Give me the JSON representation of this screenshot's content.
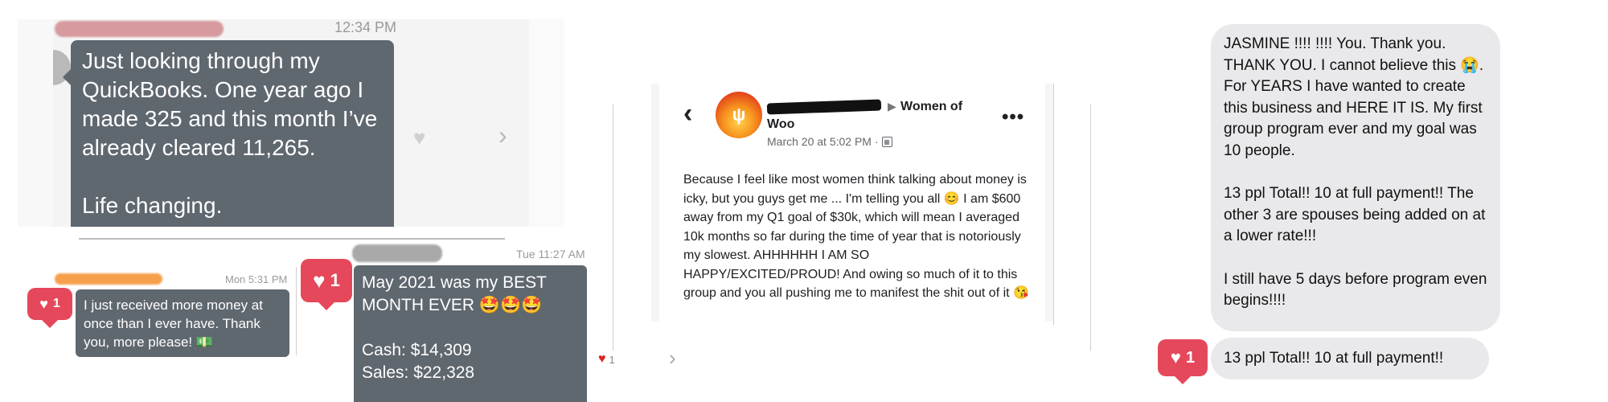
{
  "panel1": {
    "time": "12:34 PM",
    "message": "Just looking through my QuickBooks.  One year ago I made 325 and this month I’ve already cleared 11,265.\n\nLife changing."
  },
  "panel2": {
    "time": "Mon 5:31 PM",
    "message": "I just received more money at once than I ever have. Thank you, more please! 💵",
    "heart_count": "1"
  },
  "panel3": {
    "time": "Tue 11:27 AM",
    "message": "May 2021 was my BEST MONTH EVER 🤩🤩🤩\n\nCash: $14,309\nSales: $22,328",
    "heart_count": "1",
    "reaction_count": "1"
  },
  "panel4": {
    "group": "Women of Woo",
    "date": "March 20 at 5:02 PM · ",
    "post": "Because I feel like most women think talking about money is icky, but you guys get me ... I'm telling you all 😊 I am $600 away from my Q1 goal of $30k, which will mean I averaged 10k months so far during the time of year that is notoriously my slowest. AHHHHHH I AM SO HAPPY/EXCITED/PROUD! And owing so much of it to this group and you all pushing me to manifest the shit out of it 😘"
  },
  "panel5": {
    "message": "JASMINE !!!! !!!! You. Thank you. THANK YOU. I cannot believe this 😭. For YEARS I have wanted to create this business and HERE IT IS. My first group program ever and my goal was 10 people.\n\n13 ppl Total!! 10 at full payment!! The other 3 are spouses being added on at a lower rate!!!\n\nI still have 5 days before program even begins!!!!",
    "reply": "13 ppl Total!! 10 at full payment!!",
    "heart_count": "1"
  },
  "icons": [
    "heart-icon",
    "chevron-right-icon",
    "back-icon",
    "more-icon",
    "fire-logo-icon",
    "globe-icon"
  ],
  "colors": {
    "dark_bubble": "#5f676f",
    "gray_bubble": "#e9e9eb",
    "heart_red": "#e5485a",
    "fire_orange": "#f26b21"
  }
}
